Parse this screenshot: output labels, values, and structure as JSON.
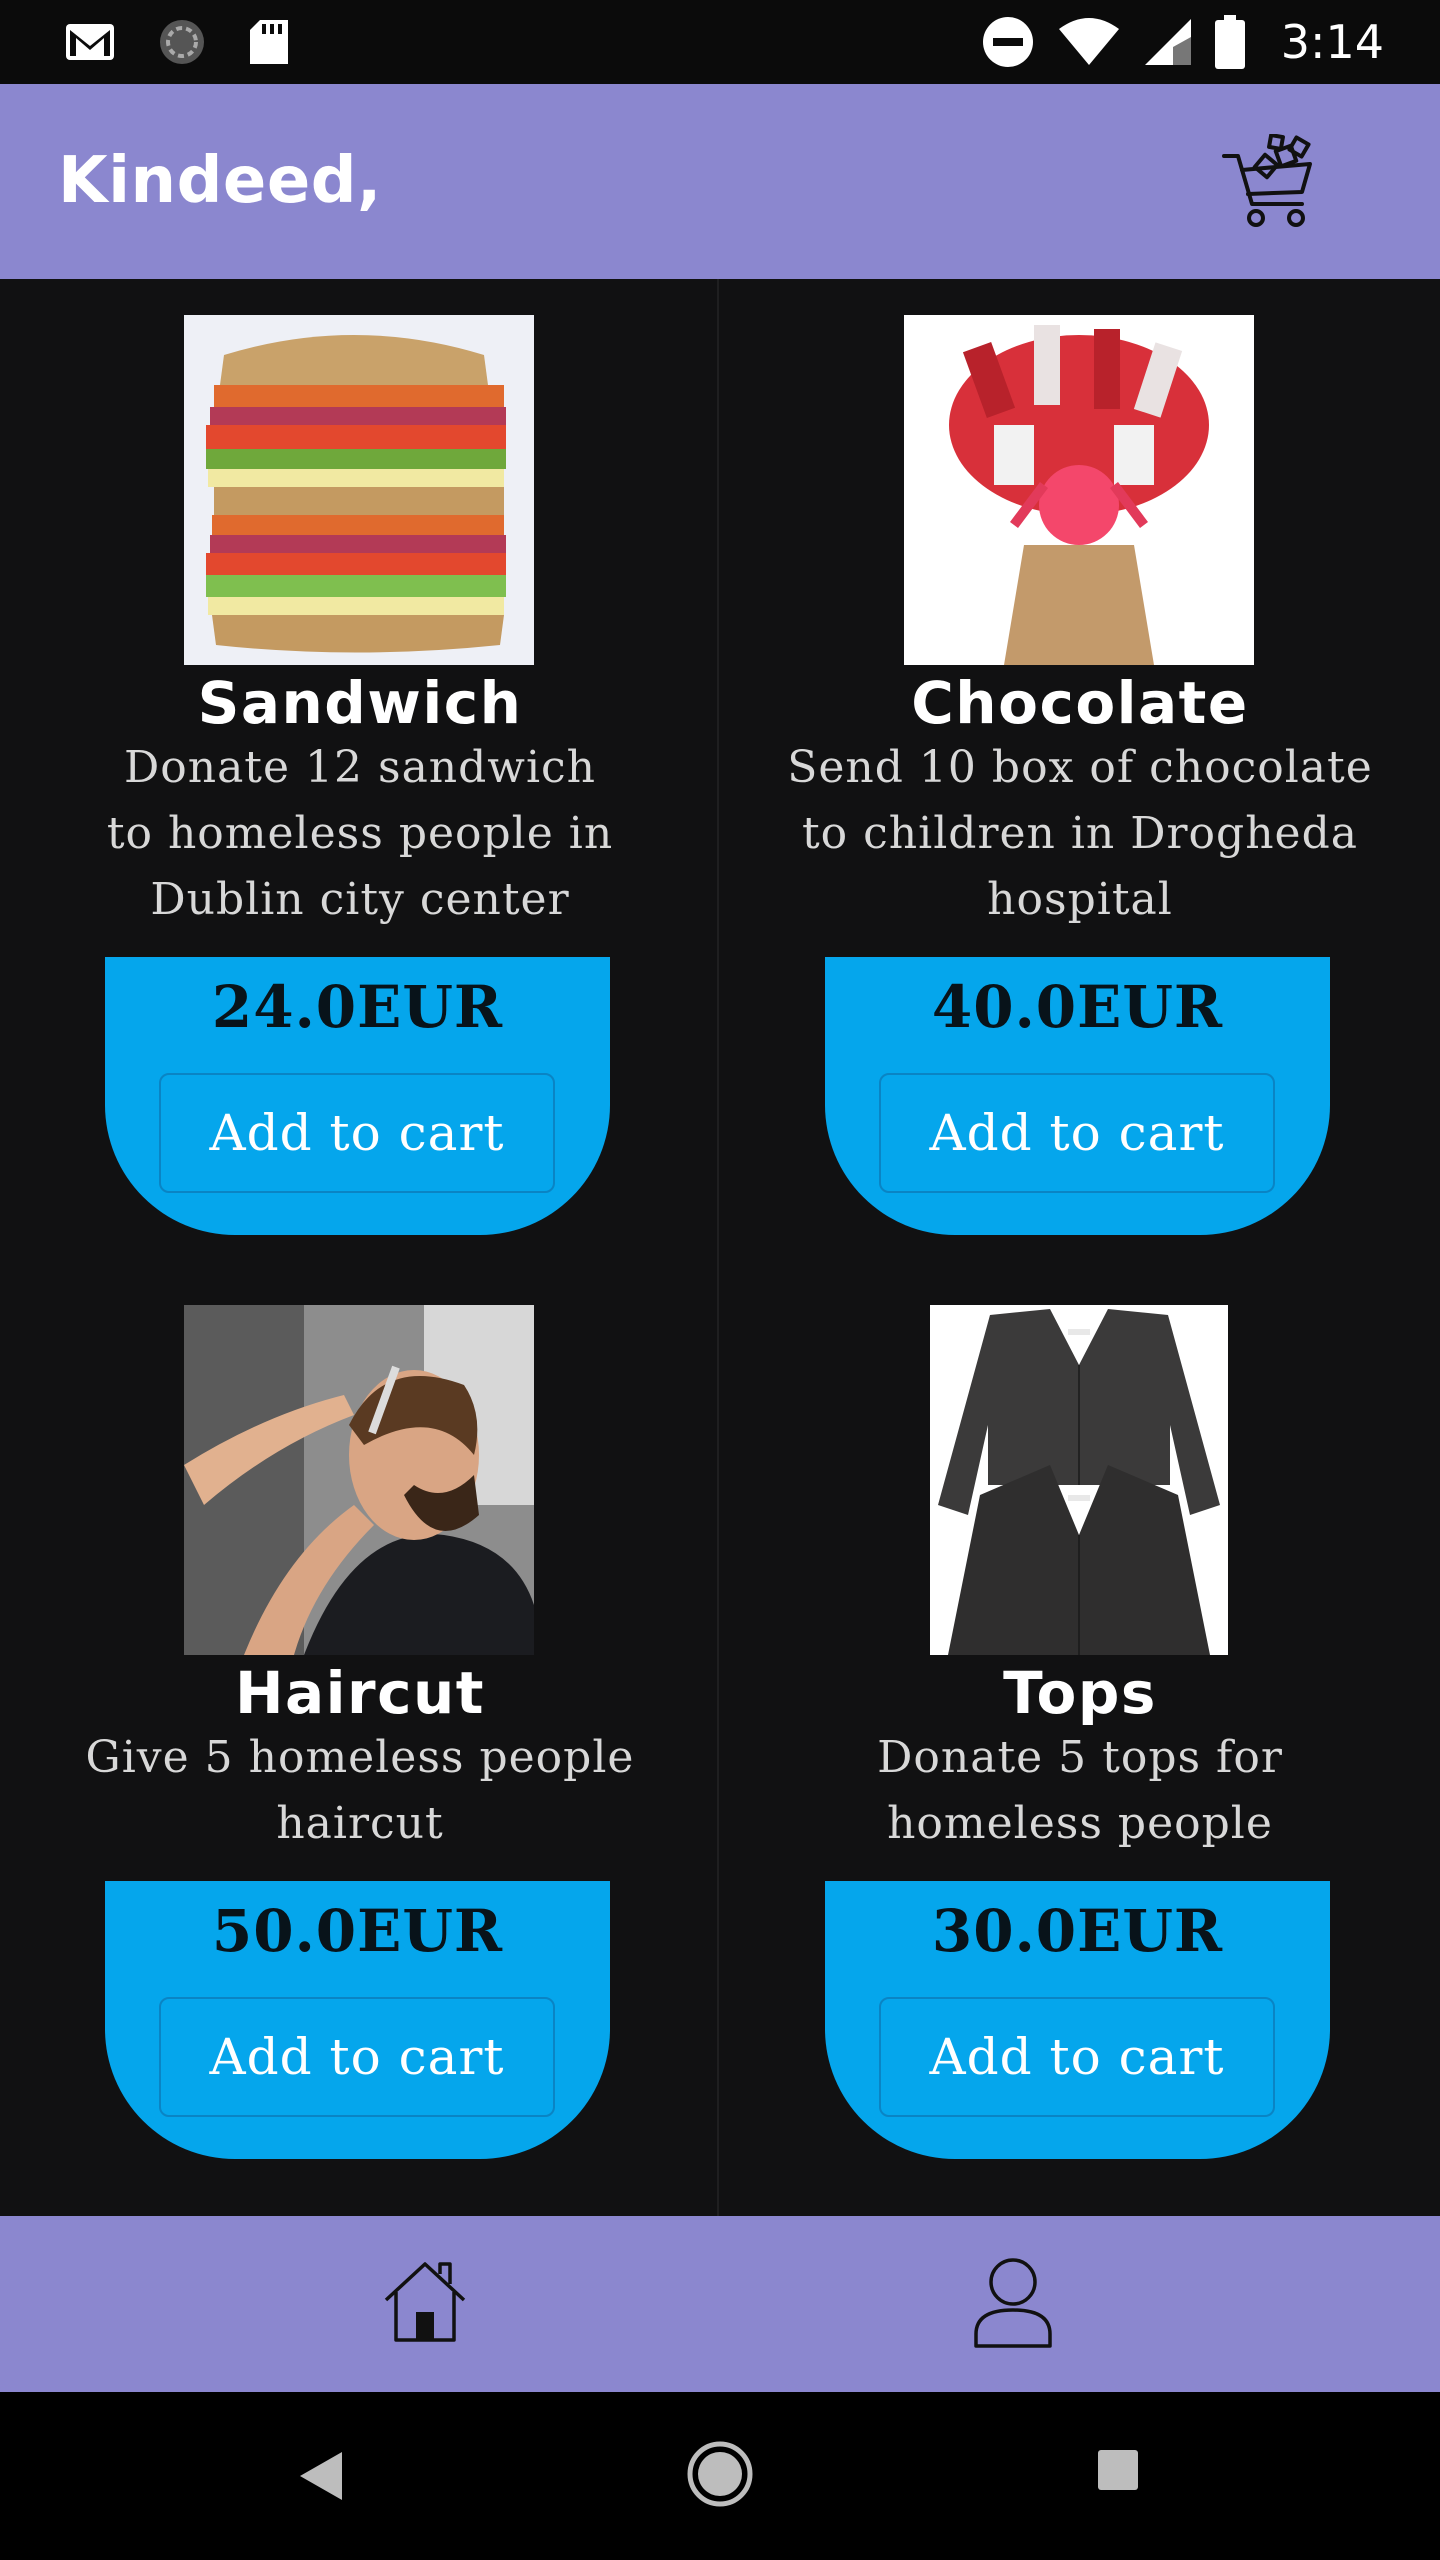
{
  "status_bar": {
    "time": "3:14",
    "icons_left": [
      "gmail-icon",
      "sync-icon",
      "sd-card-icon"
    ],
    "icons_right": [
      "do-not-disturb-icon",
      "wifi-icon",
      "signal-icon",
      "battery-icon"
    ]
  },
  "app_bar": {
    "title": "Kindeed,",
    "cart_icon": "cart-icon"
  },
  "products": [
    {
      "name": "Sandwich",
      "description": "Donate 12 sandwich to homeless people in Dublin city center",
      "description_lines": [
        "Donate 12 sandwich",
        "to homeless people in",
        "Dublin city center"
      ],
      "price": "24.0EUR",
      "button": "Add to cart",
      "image": "sandwich-image"
    },
    {
      "name": "Chocolate",
      "description": "Send 10 box of chocolate to children in Drogheda hospital",
      "description_lines": [
        "Send 10 box of chocolate",
        "to children in Drogheda",
        "hospital"
      ],
      "price": "40.0EUR",
      "button": "Add to cart",
      "image": "chocolate-bouquet-image"
    },
    {
      "name": "Haircut",
      "description": "Give 5 homeless people haircut",
      "description_lines": [
        "Give 5 homeless people",
        "haircut"
      ],
      "price": "50.0EUR",
      "button": "Add to cart",
      "image": "haircut-image"
    },
    {
      "name": "Tops",
      "description": "Donate 5 tops for homeless people",
      "description_lines": [
        "Donate 5 tops for",
        "homeless people"
      ],
      "price": "30.0EUR",
      "button": "Add to cart",
      "image": "cardigan-tops-image"
    }
  ],
  "bottom_nav": {
    "items": [
      {
        "icon": "home-icon"
      },
      {
        "icon": "profile-icon"
      }
    ]
  },
  "system_nav": [
    "back-icon",
    "home-circle-icon",
    "recents-icon"
  ],
  "colors": {
    "app_bar": "#8b87cf",
    "background": "#111112",
    "price_box": "#05a6ec",
    "text": "#ffffff"
  }
}
